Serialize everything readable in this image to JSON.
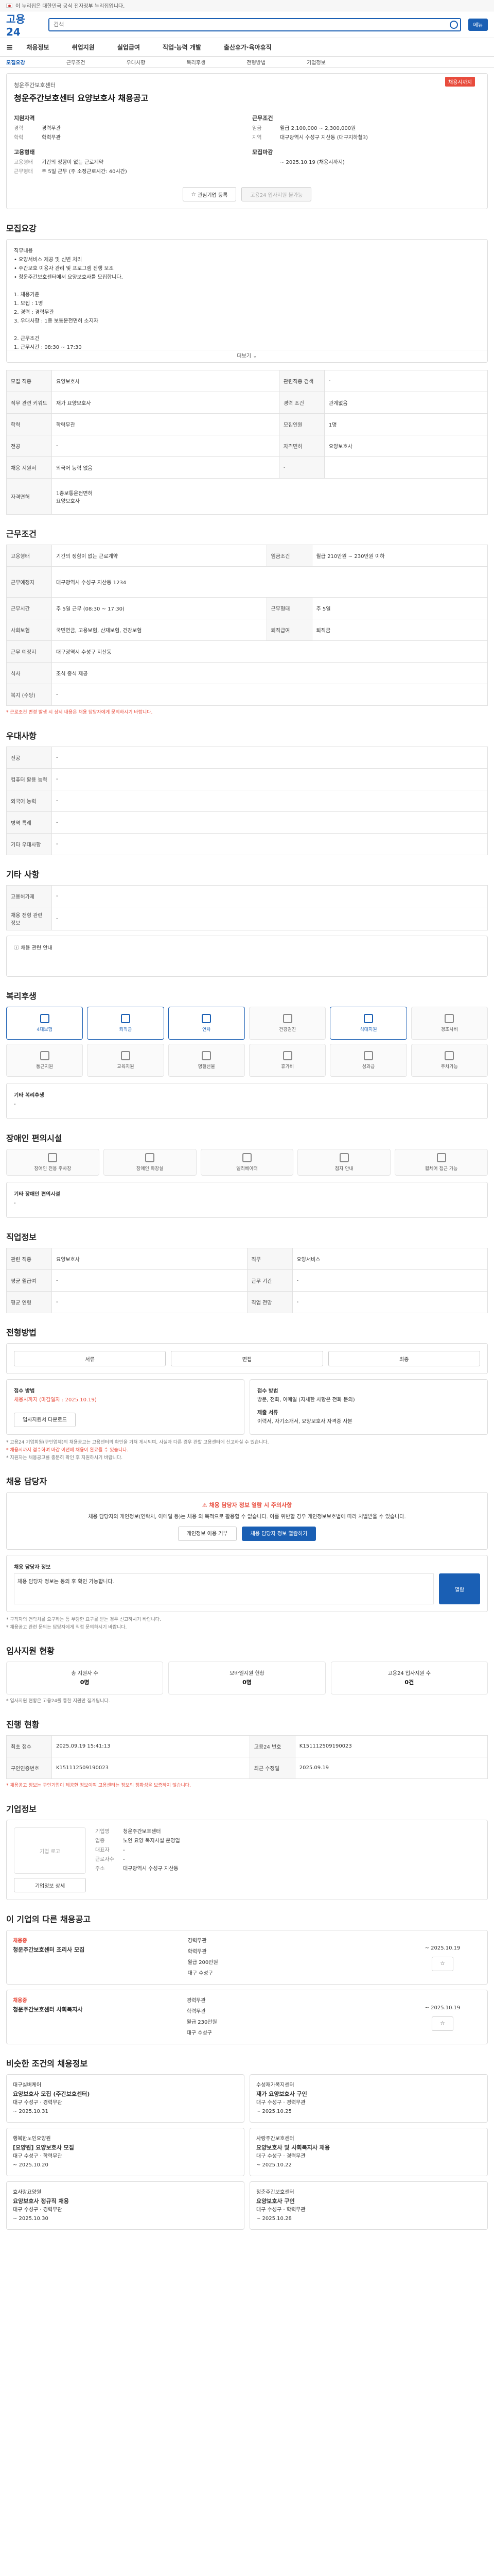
{
  "topbar": {
    "text": "이 누리집은 대한민국 공식 전자정부 누리집입니다."
  },
  "header": {
    "logo": "고용24",
    "search_placeholder": "검색",
    "btn": "메뉴"
  },
  "gnb": {
    "items": [
      "채용정보",
      "취업지원",
      "실업급여",
      "직업·능력 개발",
      "출산휴가·육아휴직"
    ]
  },
  "snb": {
    "items": [
      "모집요강",
      "근무조건",
      "우대사항",
      "복리후생",
      "전형방법",
      "기업정보"
    ]
  },
  "job": {
    "corp": "청운주간보호센터",
    "title": "청운주간보호센터 요양보호사 채용공고",
    "dday": "채용시까지",
    "left_title": "지원자격",
    "left": [
      [
        "경력",
        "경력무관"
      ],
      [
        "학력",
        "학력무관"
      ]
    ],
    "right_title": "근무조건",
    "right": [
      [
        "임금",
        "월급 2,100,000 ~ 2,300,000원"
      ],
      [
        "지역",
        "대구광역시 수성구 지산동 (대구지하철3)"
      ]
    ],
    "left2_title": "고용형태",
    "left2": [
      [
        "고용형태",
        "기간의 정함이 없는 근로계약"
      ],
      [
        "근무형태",
        "주 5일 근무 (주 소정근로시간: 40시간)"
      ]
    ],
    "right2_title": "모집마감",
    "right2": [
      [
        "",
        "~ 2025.10.19 (채용시까지)"
      ]
    ],
    "btn_interest": "관심기업 등록",
    "btn_apply": "고용24 입사지원 불가능"
  },
  "recruit": {
    "title": "모집요강",
    "desc": "직무내용\n• 요양서비스 제공 및 신변 처리\n• 주간보호 이용자 관리 및 프로그램 진행 보조\n• 청운주간보호센터에서 요양보호사를 모집합니다.\n\n1. 채용기준\n 1. 모집 : 1명\n 2. 경력 : 경력무관\n 3. 우대사항 : 1종 보통운전면허 소지자\n\n2. 근무조건\n 1. 근무시간 : 08:30 ~ 17:30\n 2. 근무일 : 주 5일\n 3. 급여 : 월 210~230만원",
    "more": "더보기",
    "rows": [
      [
        [
          "모집 직종",
          "요양보호사"
        ],
        [
          "관련직종 검색",
          "-"
        ]
      ],
      [
        [
          "직무 관련 키워드",
          "재가 요양보호사"
        ],
        [
          "경력 조건",
          "관계없음"
        ]
      ],
      [
        [
          "학력",
          "학력무관"
        ],
        [
          "모집인원",
          "1명"
        ]
      ],
      [
        [
          "전공",
          "-"
        ],
        [
          "자격면허",
          "요양보호사"
        ]
      ],
      [
        [
          "채용 지원서",
          "외국어 능력 없음"
        ],
        [
          "-",
          ""
        ]
      ]
    ],
    "license": "1종보통운전면허",
    "license2": "요양보호사"
  },
  "conditions": {
    "title": "근무조건",
    "rows": [
      [
        [
          "고용형태",
          "기간의 정함이 없는 근로계약"
        ],
        [
          "임금조건",
          "월급 210만원 ~ 230만원 이하"
        ]
      ],
      [
        [
          "근무예정지",
          "대구광역시 수성구 지산동 1234"
        ],
        [
          "",
          ""
        ]
      ],
      [
        [
          "근무시간",
          "주 5일 근무 (08:30 ~ 17:30)"
        ],
        [
          "근무형태",
          "주 5일"
        ]
      ],
      [
        [
          "사회보험",
          "국민연금, 고용보험, 산재보험, 건강보험"
        ],
        [
          "퇴직급여",
          "퇴직금"
        ]
      ],
      [
        [
          "근무 예정지",
          "대구광역시 수성구 지산동"
        ],
        [
          "",
          ""
        ]
      ],
      [
        [
          "식사",
          "조식 중식 제공"
        ],
        [
          "",
          ""
        ]
      ],
      [
        [
          "복지 (수당)",
          "-"
        ],
        [
          "",
          ""
        ]
      ]
    ],
    "note": "* 근로조건 변경 발생 시 상세 내용은 채용 담당자에게 문의하시기 바랍니다."
  },
  "preferred": {
    "title": "우대사항",
    "rows": [
      [
        "전공",
        "-"
      ],
      [
        "컴퓨터 활용 능력",
        "-"
      ],
      [
        "외국어 능력",
        "-"
      ],
      [
        "병역 특례",
        "-"
      ],
      [
        "기타 우대사항",
        "-"
      ]
    ]
  },
  "other": {
    "title": "기타 사항",
    "rows": [
      [
        "고용허가제",
        "-"
      ],
      [
        "채용 전형 관련 정보",
        "-"
      ]
    ],
    "note": "채용 관련 안내"
  },
  "welfare": {
    "title": "복리후생",
    "items": [
      "4대보험",
      "퇴직금",
      "연차",
      "건강검진",
      "식대지원",
      "경조사비",
      "통근지원",
      "교육지원",
      "명절선물",
      "휴가비",
      "성과급",
      "주차가능"
    ],
    "on": [
      0,
      1,
      2,
      4
    ],
    "extra_title": "기타 복리후생",
    "extra": "-"
  },
  "facility": {
    "title": "장애인 편의시설",
    "items": [
      "장애인 전용 주차장",
      "장애인 화장실",
      "엘리베이터",
      "점자 안내",
      "휠체어 접근 가능"
    ],
    "extra_title": "기타 장애인 편의시설",
    "extra": "-"
  },
  "jobinfo": {
    "title": "직업정보",
    "rows": [
      [
        "관련 직종",
        "요양보호사"
      ],
      [
        "직무",
        "요양서비스"
      ],
      [
        "평균 월급여",
        "-"
      ],
      [
        "근무 기간",
        "-"
      ],
      [
        "평균 연령",
        "-"
      ],
      [
        "직업 전망",
        "-"
      ]
    ]
  },
  "method": {
    "title": "전형방법",
    "buttons": [
      "서류",
      "면접",
      "최종"
    ],
    "apply_title": "접수 방법",
    "apply_period": "채용시까지 (마감일자 : 2025.10.19)",
    "apply_methods": "방문, 전화, 이메일 (자세한 사항은 전화 문의)",
    "docs_title": "제출 서류",
    "docs": "이력서, 자기소개서, 요양보호사 자격증 사본",
    "download": "입사지원서 다운로드",
    "notes": [
      "* 고용24 기업회원(구인업체)의 채용공고는 고용센터의 확인을 거쳐 게시되며, 사실과 다른 경우 관할 고용센터에 신고하실 수 있습니다.",
      "* 채용시까지 접수하며 마감 이전에 채용이 완료될 수 있습니다.",
      "* 지원자는 채용공고를 충분히 확인 후 지원하시기 바랍니다."
    ]
  },
  "contact": {
    "title": "채용 담당자",
    "alert_title": "채용 담당자 정보 열람 시 주의사항",
    "alert": "채용 담당자의 개인정보(연락처, 이메일 등)는 채용 외 목적으로 활용할 수 없습니다. 이를 위반할 경우 개인정보보호법에 따라 처벌받을 수 있습니다.",
    "btn_cancel": "개인정보 이용 거부",
    "btn_agree": "채용 담당자 정보 열람하기",
    "guide_title": "채용 담당자 정보",
    "guide": "채용 담당자 정보는 동의 후 확인 가능합니다.",
    "btn_view": "열람",
    "notes": [
      "* 구직자의 연락처를 요구하는 등 부당한 요구를 받는 경우 신고하시기 바랍니다.",
      "* 채용공고 관련 문의는 담당자에게 직접 문의하시기 바랍니다."
    ]
  },
  "stats": {
    "title": "입사지원 현황",
    "cards": [
      [
        "총 지원자 수",
        "0",
        "명"
      ],
      [
        "모바일지원 현황",
        "0",
        "명"
      ],
      [
        "고용24 입사지원 수",
        "0",
        "건"
      ]
    ],
    "note": "* 입사지원 현황은 고용24를 통한 지원만 집계됩니다."
  },
  "process": {
    "title": "진행 현황",
    "rows": [
      [
        [
          "최초 접수",
          "2025.09.19 15:41:13"
        ],
        [
          "고용24 번호",
          "K151112509190023"
        ]
      ],
      [
        [
          "구인인증번호",
          "K151112509190023"
        ],
        [
          "최근 수정일",
          "2025.09.19"
        ]
      ]
    ],
    "note": "* 채용공고 정보는 구인기업이 제공한 정보이며 고용센터는 정보의 정확성을 보증하지 않습니다."
  },
  "company": {
    "title": "기업정보",
    "logo": "기업 로고",
    "name": "청운주간보호센터",
    "rows": [
      [
        "기업명",
        "청운주간보호센터"
      ],
      [
        "업종",
        "노인 요양 복지시설 운영업"
      ],
      [
        "대표자",
        "-"
      ],
      [
        "근로자수",
        "-"
      ],
      [
        "주소",
        "대구광역시 수성구 지산동"
      ]
    ],
    "btn": "기업정보 상세"
  },
  "recommend": {
    "title": "이 기업의 다른 채용공고",
    "items": [
      {
        "tag": "채용중",
        "title": "청운주간보호센터 조리사 모집",
        "c1": "경력무관",
        "c2": "학력무관",
        "c3": "월급 200만원",
        "loc": "대구 수성구",
        "date": "~ 2025.10.19"
      },
      {
        "tag": "채용중",
        "title": "청운주간보호센터 사회복지사",
        "c1": "경력무관",
        "c2": "학력무관",
        "c3": "월급 230만원",
        "loc": "대구 수성구",
        "date": "~ 2025.10.19"
      }
    ]
  },
  "similar": {
    "title": "비슷한 조건의 채용정보",
    "items": [
      {
        "corp": "대구실버케어",
        "title": "요양보호사 모집 (주간보호센터)",
        "info": "대구 수성구 · 경력무관",
        "date": "~ 2025.10.31"
      },
      {
        "corp": "수성재가복지센터",
        "title": "재가 요양보호사 구인",
        "info": "대구 수성구 · 경력무관",
        "date": "~ 2025.10.25"
      },
      {
        "corp": "행복한노인요양원",
        "title": "[요양원] 요양보호사 모집",
        "info": "대구 수성구 · 학력무관",
        "date": "~ 2025.10.20"
      },
      {
        "corp": "사랑주간보호센터",
        "title": "요양보호사 및 사회복지사 채용",
        "info": "대구 수성구 · 경력무관",
        "date": "~ 2025.10.22"
      },
      {
        "corp": "효사랑요양원",
        "title": "요양보호사 정규직 채용",
        "info": "대구 수성구 · 경력무관",
        "date": "~ 2025.10.30"
      },
      {
        "corp": "청춘주간보호센터",
        "title": "요양보호사 구인",
        "info": "대구 수성구 · 학력무관",
        "date": "~ 2025.10.28"
      }
    ]
  }
}
